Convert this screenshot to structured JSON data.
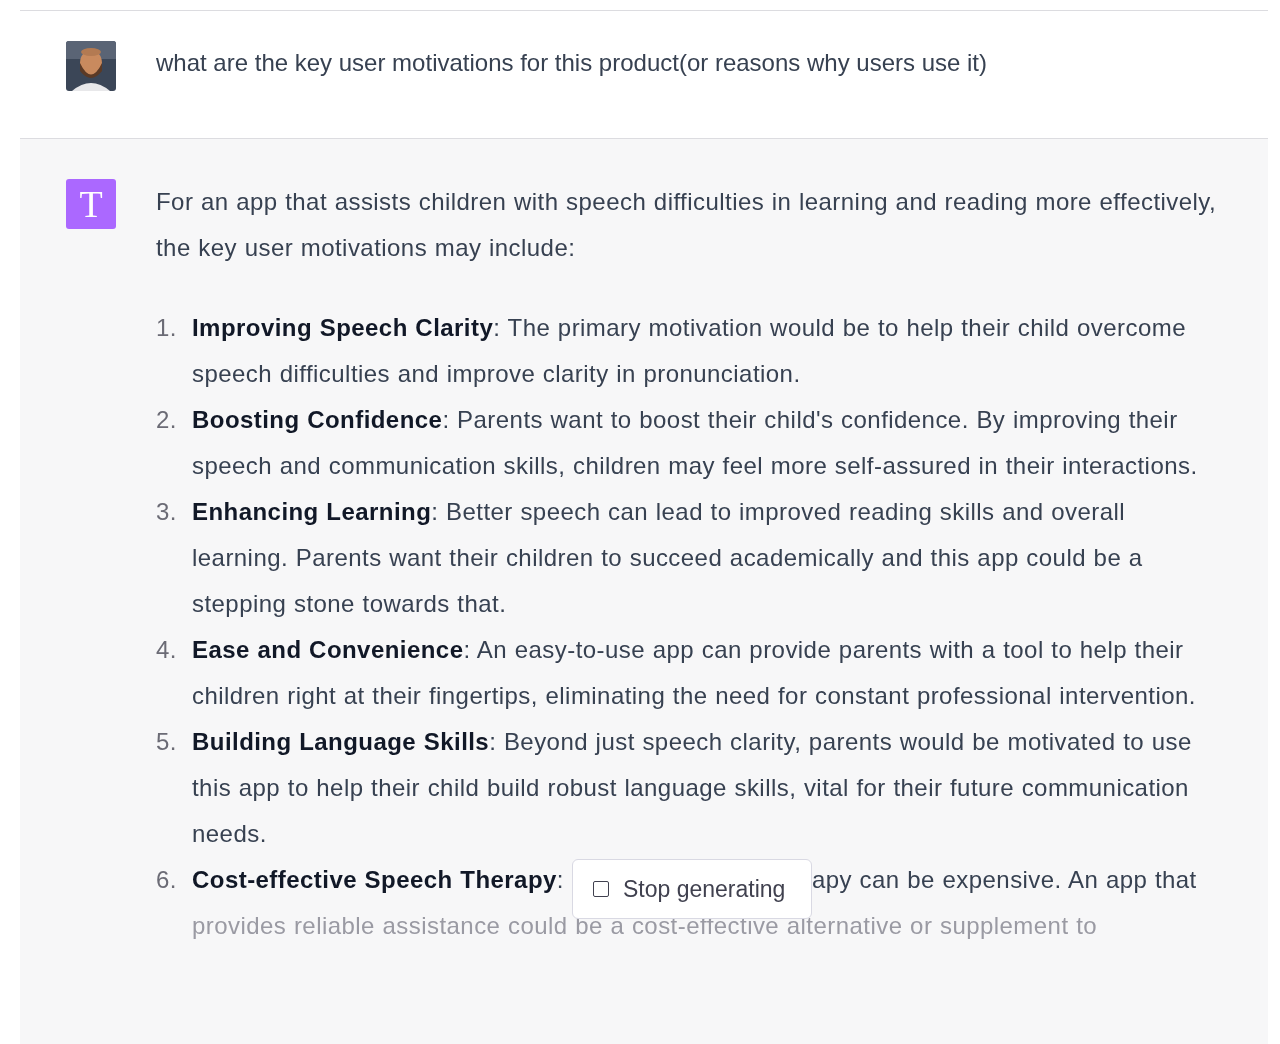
{
  "user_message": {
    "text": "what are the key user motivations for this product(or reasons why users use it)"
  },
  "assistant_message": {
    "avatar_letter": "T",
    "intro": "For an app that assists children with speech difficulties in learning and reading more effectively, the key user motivations may include:",
    "items": [
      {
        "kind": "full",
        "number": "1.",
        "heading": "Improving Speech Clarity",
        "text": ": The primary motivation would be to help their child overcome speech difficulties and improve clarity in pronunciation."
      },
      {
        "kind": "full",
        "number": "2.",
        "heading": "Boosting Confidence",
        "text": ": Parents want to boost their child's confidence. By improving their speech and communication skills, children may feel more self-assured in their interactions."
      },
      {
        "kind": "full",
        "number": "3.",
        "heading": "Enhancing Learning",
        "text": ": Better speech can lead to improved reading skills and overall learning. Parents want their children to succeed academically and this app could be a stepping stone towards that."
      },
      {
        "kind": "full",
        "number": "4.",
        "heading": "Ease and Convenience",
        "text": ": An easy-to-use app can provide parents with a tool to help their children right at their fingertips, eliminating the need for constant professional intervention."
      },
      {
        "kind": "full",
        "number": "5.",
        "heading": "Building Language Skills",
        "text": ": Beyond just speech clarity, parents would be motivated to use this app to help their child build robust language skills, vital for their future communication needs."
      },
      {
        "kind": "covered",
        "number": "6.",
        "heading": "Cost-effective Speech Therapy",
        "text": ":",
        "lines": [
          "apy can be expensive. An app that",
          "provides reliable assistance could be a cost-effective alternative or supplement to"
        ]
      }
    ]
  },
  "stop_button": {
    "label": "Stop generating"
  }
}
